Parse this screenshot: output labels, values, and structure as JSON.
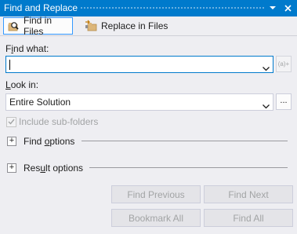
{
  "window": {
    "title": "Find and Replace"
  },
  "tabs": [
    {
      "label": "Find in Files",
      "active": true,
      "icon": "find-in-files-icon"
    },
    {
      "label": "Replace in Files",
      "active": false,
      "icon": "replace-in-files-icon"
    }
  ],
  "find_what": {
    "label": "Find what:",
    "value": "",
    "regex_button_label": "(a)+"
  },
  "look_in": {
    "label": "Look in:",
    "value": "Entire Solution",
    "browse_label": "..."
  },
  "include_subfolders": {
    "label": "Include sub-folders",
    "checked": true,
    "enabled": false
  },
  "sections": {
    "find_options": "Find options",
    "result_options": "Result options"
  },
  "buttons": {
    "find_previous": "Find Previous",
    "find_next": "Find Next",
    "bookmark_all": "Bookmark All",
    "find_all": "Find All"
  },
  "colors": {
    "accent": "#007acc",
    "background": "#eeeef2",
    "disabled_text": "#a2a4a5"
  }
}
